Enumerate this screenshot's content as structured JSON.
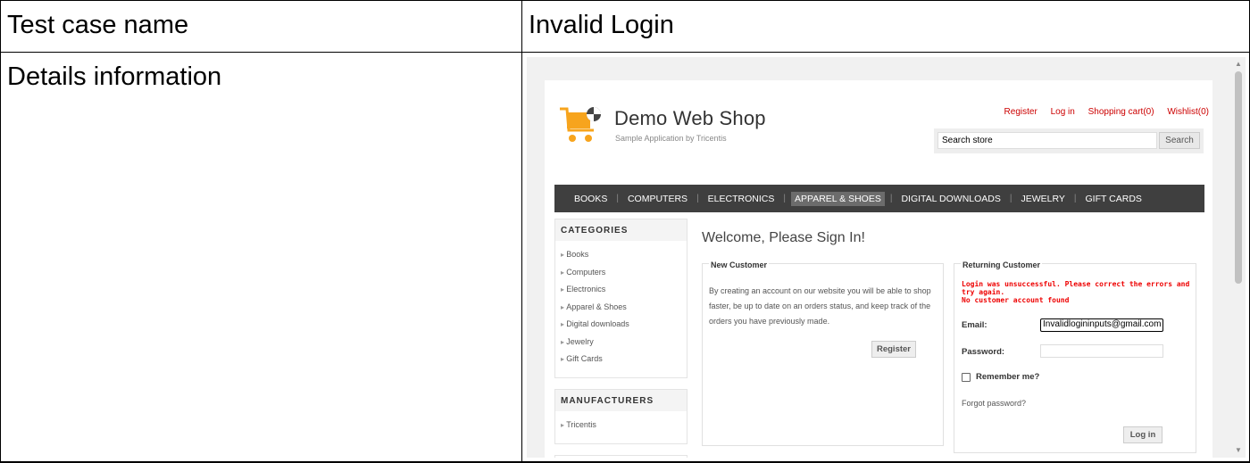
{
  "test_case": {
    "name_label": "Test case name",
    "name_value": "Invalid Login",
    "details_label": "Details information"
  },
  "shop": {
    "title": "Demo Web Shop",
    "subtitle": "Sample Application by Tricentis",
    "header_links": [
      "Register",
      "Log in",
      "Shopping cart(0)",
      "Wishlist(0)"
    ],
    "search": {
      "value": "Search store",
      "button": "Search"
    },
    "menu": [
      "BOOKS",
      "COMPUTERS",
      "ELECTRONICS",
      "APPAREL & SHOES",
      "DIGITAL DOWNLOADS",
      "JEWELRY",
      "GIFT CARDS"
    ],
    "menu_active": "APPAREL & SHOES",
    "categories": {
      "title": "CATEGORIES",
      "items": [
        "Books",
        "Computers",
        "Electronics",
        "Apparel & Shoes",
        "Digital downloads",
        "Jewelry",
        "Gift Cards"
      ]
    },
    "manufacturers": {
      "title": "MANUFACTURERS",
      "items": [
        "Tricentis"
      ]
    },
    "welcome": "Welcome, Please Sign In!",
    "new_customer": {
      "title": "New Customer",
      "text": "By creating an account on our website you will be able to shop faster, be up to date on an orders status, and keep track of the orders you have previously made.",
      "button": "Register"
    },
    "returning": {
      "title": "Returning Customer",
      "error_line1": "Login was unsuccessful. Please correct the errors and try again.",
      "error_line2": "No customer account found",
      "email_label": "Email:",
      "email_value": "Invalidlogininputs@gmail.com",
      "password_label": "Password:",
      "password_value": "",
      "remember_label": "Remember me?",
      "forgot_label": "Forgot password?",
      "login_button": "Log in"
    },
    "colors": {
      "accent": "#cc0000",
      "menu_bg": "#3f3f3f",
      "logo_orange": "#f7a41d"
    }
  }
}
